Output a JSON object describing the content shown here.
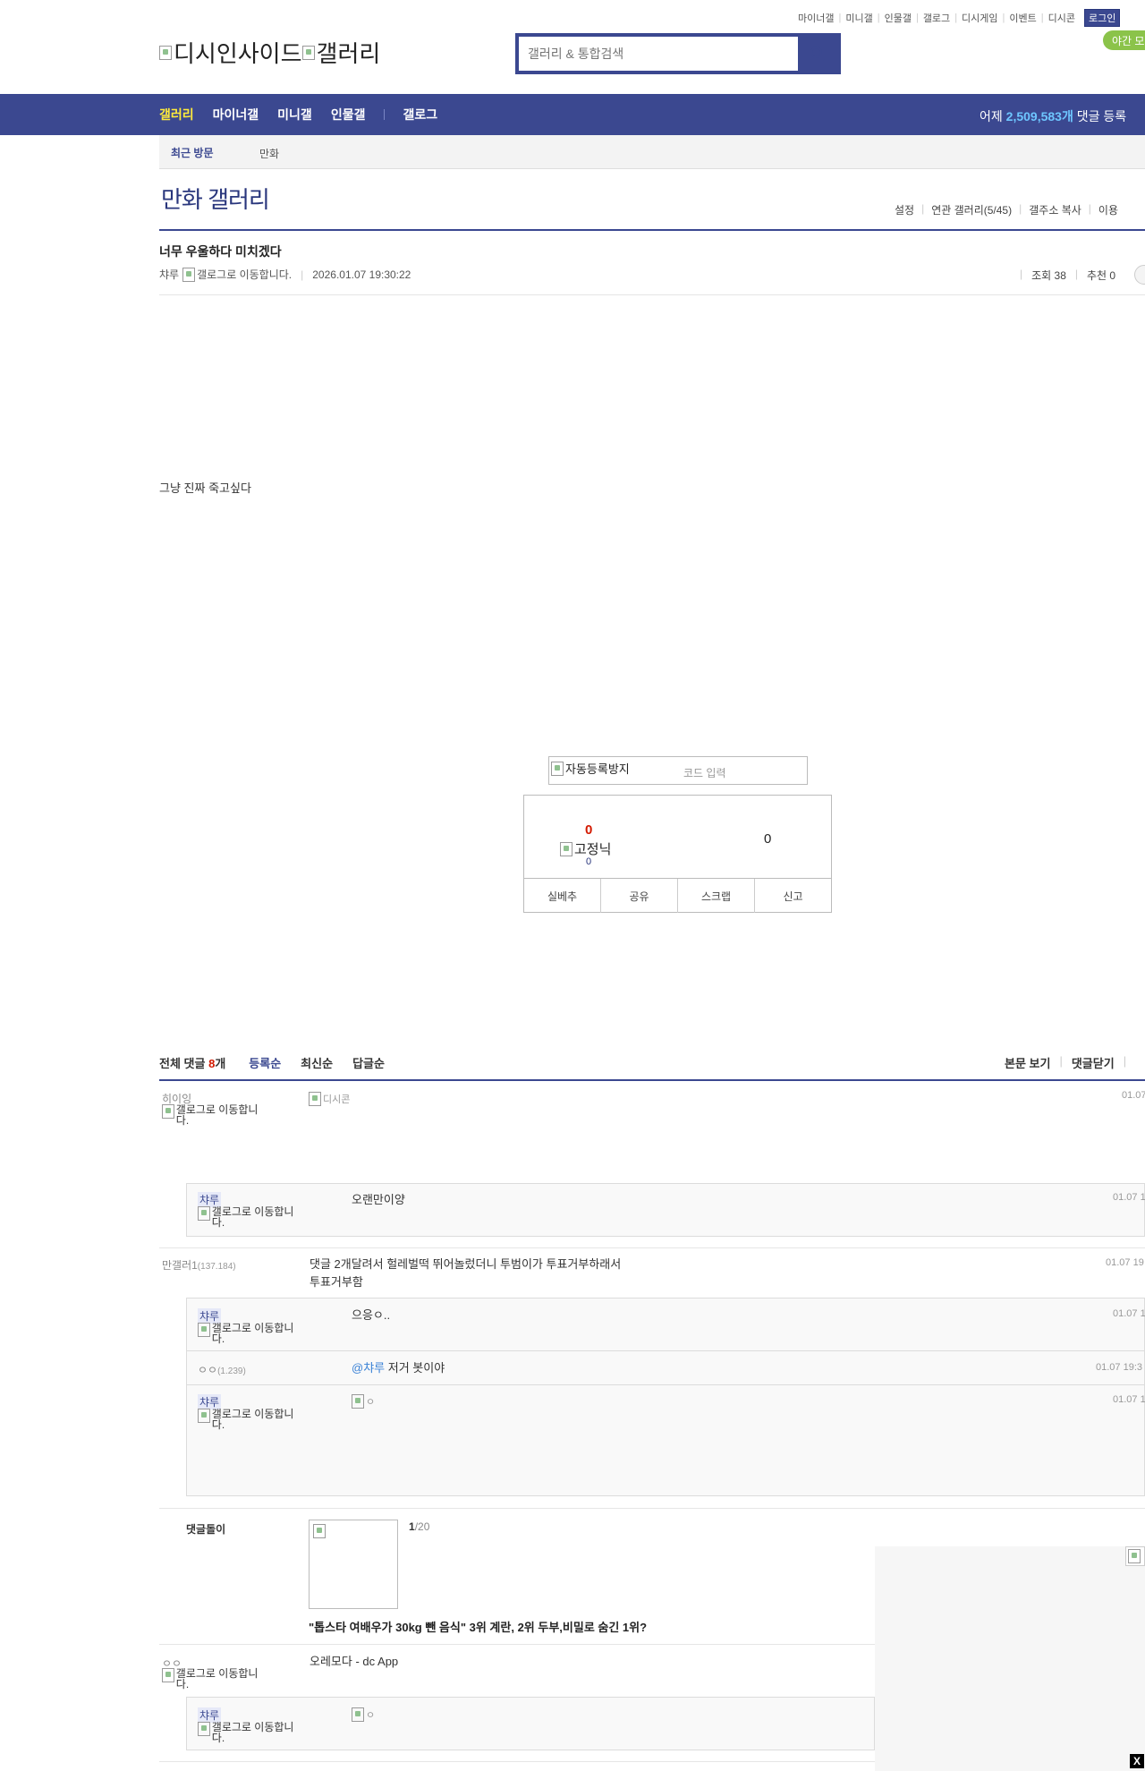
{
  "top_links": [
    "마이너갤",
    "미니갤",
    "인물갤",
    "갤로그",
    "디시게임",
    "이벤트",
    "디시콘"
  ],
  "login_label": "로그인",
  "night_mode_label": "야간 모",
  "logo": {
    "site": "디시인사이드",
    "section": "갤러리"
  },
  "search": {
    "placeholder": "갤러리 & 통합검색"
  },
  "nav": {
    "items": [
      "갤러리",
      "마이너갤",
      "미니갤",
      "인물갤",
      "갤로그"
    ],
    "stat_prefix": "어제 ",
    "stat_count": "2,509,583개",
    "stat_suffix": " 댓글 등록"
  },
  "recent": {
    "label": "최근 방문",
    "item": "만화"
  },
  "gallery": {
    "title": "만화 갤러리",
    "menu": [
      "설정",
      "연관 갤러리(5/45)",
      "갤주소 복사",
      "이용"
    ]
  },
  "post": {
    "title": "너무 우울하다 미치겠다",
    "author": "챠루",
    "gallog_alt": "갤로그로 이동합니다.",
    "date": "2026.01.07 19:30:22",
    "views": "조회 38",
    "recommends": "추천 0",
    "body": "그냥 진짜 죽고싶다"
  },
  "captcha": {
    "alt": "자동등록방지",
    "placeholder": "코드 입력"
  },
  "vote": {
    "up": "0",
    "fixed_alt": "고정닉",
    "fixed_count": "0",
    "down": "0",
    "buttons": [
      "실베추",
      "공유",
      "스크랩",
      "신고"
    ]
  },
  "comments_header": {
    "total_label": "전체 댓글 ",
    "total_count": "8",
    "total_unit": "개",
    "sort": [
      "등록순",
      "최신순",
      "답글순"
    ],
    "right": [
      "본문 보기",
      "댓글닫기"
    ]
  },
  "comments": {
    "c1": {
      "nick": "히이잉",
      "gallog": "갤로그로 이동합니다.",
      "img_alt": "디시콘",
      "date": "01.07"
    },
    "r1": {
      "nick": "챠루",
      "gallog": "갤로그로 이동합니다.",
      "text": "오랜만이양",
      "date": "01.07 1"
    },
    "c2": {
      "nick": "만갤러1",
      "ip": "(137.184)",
      "text1": "댓글 2개달려서 헐레벌떡 뛰어놀렀더니 투범이가 투표거부하래서",
      "text2": "투표거부함",
      "date": "01.07 19"
    },
    "r2": {
      "nick": "챠루",
      "gallog": "갤로그로 이동합니다.",
      "text": "으응ㅇ..",
      "date": "01.07 1"
    },
    "r3": {
      "nick": "ㅇㅇ",
      "ip": "(1.239)",
      "mention": "@챠루",
      "text": " 저거 봇이야",
      "date": "01.07 19:3"
    },
    "r4": {
      "nick": "챠루",
      "gallog": "갤로그로 이동합니다.",
      "img_alt": "ㅇ",
      "date": "01.07 1"
    },
    "dolly": {
      "label": "댓글돌이",
      "page": "1",
      "total": "/20",
      "headline": "\"톱스타 여배우가 30kg 뺀 음식\" 3위 계란, 2위 두부,비밀로 숨긴 1위?"
    },
    "c3": {
      "nick": "ㅇㅇ",
      "gallog": "갤로그로 이동합니다.",
      "text": "오레모다 - dc App"
    },
    "r5": {
      "nick": "챠루",
      "gallog": "갤로그로 이동합니다.",
      "img_alt": "ㅇ"
    }
  },
  "close_label": "X",
  "colors": {
    "brand": "#3b4890",
    "highlight": "#ffeb3b",
    "count": "#d31900",
    "night": "#8bc34a"
  }
}
